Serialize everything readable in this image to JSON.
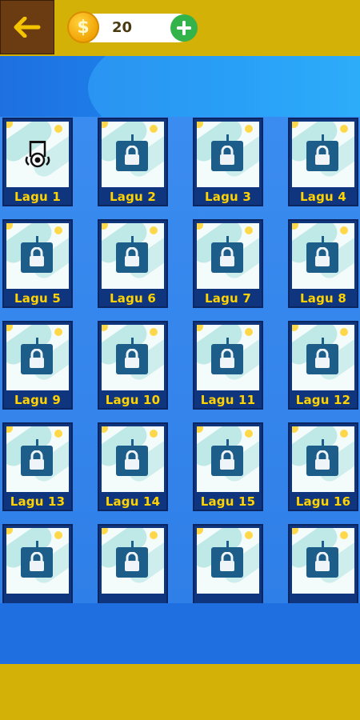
{
  "header": {
    "back_icon": "arrow-left-icon",
    "coins": "20",
    "coin_icon": "$",
    "add_icon": "plus-icon"
  },
  "songs": [
    {
      "label": "Lagu 1",
      "locked": false
    },
    {
      "label": "Lagu 2",
      "locked": true
    },
    {
      "label": "Lagu 3",
      "locked": true
    },
    {
      "label": "Lagu 4",
      "locked": true
    },
    {
      "label": "Lagu 5",
      "locked": true
    },
    {
      "label": "Lagu 6",
      "locked": true
    },
    {
      "label": "Lagu 7",
      "locked": true
    },
    {
      "label": "Lagu 8",
      "locked": true
    },
    {
      "label": "Lagu 9",
      "locked": true
    },
    {
      "label": "Lagu 10",
      "locked": true
    },
    {
      "label": "Lagu 11",
      "locked": true
    },
    {
      "label": "Lagu 12",
      "locked": true
    },
    {
      "label": "Lagu 13",
      "locked": true
    },
    {
      "label": "Lagu 14",
      "locked": true
    },
    {
      "label": "Lagu 15",
      "locked": true
    },
    {
      "label": "Lagu 16",
      "locked": true
    },
    {
      "label": "",
      "locked": true
    },
    {
      "label": "",
      "locked": true
    },
    {
      "label": "",
      "locked": true
    },
    {
      "label": "",
      "locked": true
    }
  ],
  "colors": {
    "topbar": "#d4b106",
    "background": "#1f6fe0",
    "card_label": "#ffd200"
  }
}
